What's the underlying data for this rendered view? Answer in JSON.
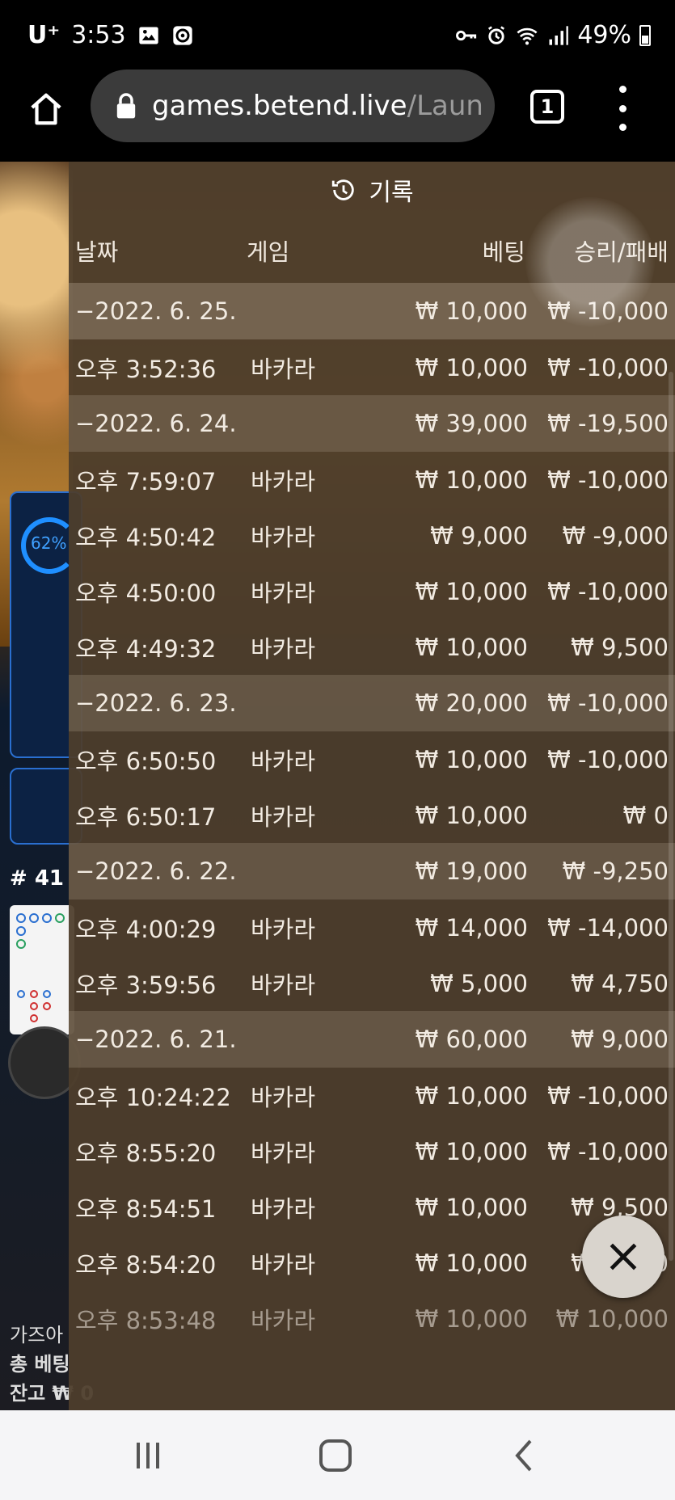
{
  "status": {
    "carrier": "U⁺",
    "time": "3:53",
    "battery": "49%"
  },
  "browser": {
    "url_host": "games.betend.live",
    "url_path": "/Laun",
    "tab_count": "1"
  },
  "game": {
    "progress_label": "62%",
    "progress_fraction": 0.62,
    "round": "# 41",
    "footer_1": "가즈아",
    "footer_2": "총 베팅",
    "footer_3": "잔고",
    "footer_balance": "₩ 0"
  },
  "history": {
    "title": "기록",
    "columns": {
      "date": "날짜",
      "game": "게임",
      "bet": "베팅",
      "win": "승리/패배"
    },
    "rows": [
      {
        "type": "group",
        "date": "−2022. 6. 25.",
        "bet": "₩ 10,000",
        "win": "₩ -10,000"
      },
      {
        "type": "item",
        "date": "오후 3:52:36",
        "game": "바카라",
        "bet": "₩ 10,000",
        "win": "₩ -10,000"
      },
      {
        "type": "group",
        "date": "−2022. 6. 24.",
        "bet": "₩ 39,000",
        "win": "₩ -19,500"
      },
      {
        "type": "item",
        "date": "오후 7:59:07",
        "game": "바카라",
        "bet": "₩ 10,000",
        "win": "₩ -10,000"
      },
      {
        "type": "item",
        "date": "오후 4:50:42",
        "game": "바카라",
        "bet": "₩ 9,000",
        "win": "₩ -9,000"
      },
      {
        "type": "item",
        "date": "오후 4:50:00",
        "game": "바카라",
        "bet": "₩ 10,000",
        "win": "₩ -10,000"
      },
      {
        "type": "item",
        "date": "오후 4:49:32",
        "game": "바카라",
        "bet": "₩ 10,000",
        "win": "₩ 9,500"
      },
      {
        "type": "group",
        "date": "−2022. 6. 23.",
        "bet": "₩ 20,000",
        "win": "₩ -10,000"
      },
      {
        "type": "item",
        "date": "오후 6:50:50",
        "game": "바카라",
        "bet": "₩ 10,000",
        "win": "₩ -10,000"
      },
      {
        "type": "item",
        "date": "오후 6:50:17",
        "game": "바카라",
        "bet": "₩ 10,000",
        "win": "₩ 0"
      },
      {
        "type": "group",
        "date": "−2022. 6. 22.",
        "bet": "₩ 19,000",
        "win": "₩ -9,250"
      },
      {
        "type": "item",
        "date": "오후 4:00:29",
        "game": "바카라",
        "bet": "₩ 14,000",
        "win": "₩ -14,000"
      },
      {
        "type": "item",
        "date": "오후 3:59:56",
        "game": "바카라",
        "bet": "₩ 5,000",
        "win": "₩ 4,750"
      },
      {
        "type": "group",
        "date": "−2022. 6. 21.",
        "bet": "₩ 60,000",
        "win": "₩ 9,000"
      },
      {
        "type": "item",
        "date": "오후 10:24:22",
        "game": "바카라",
        "bet": "₩ 10,000",
        "win": "₩ -10,000"
      },
      {
        "type": "item",
        "date": "오후 8:55:20",
        "game": "바카라",
        "bet": "₩ 10,000",
        "win": "₩ -10,000"
      },
      {
        "type": "item",
        "date": "오후 8:54:51",
        "game": "바카라",
        "bet": "₩ 10,000",
        "win": "₩ 9,500"
      },
      {
        "type": "item",
        "date": "오후 8:54:20",
        "game": "바카라",
        "bet": "₩ 10,000",
        "win": "₩ 9,500"
      },
      {
        "type": "item",
        "date": "오후 8:53:48",
        "game": "바카라",
        "bet": "₩ 10,000",
        "win": "₩ 10,000"
      }
    ]
  },
  "colors": {
    "overlay": "#4e3e2c",
    "group_row": "#6b5c4a",
    "accent_blue": "#1f8fff",
    "balance_gold": "#e6c200"
  },
  "icons": {
    "home": "home-icon",
    "lock": "lock-icon",
    "menu": "more-vert-icon",
    "history": "history-clock-icon",
    "close": "close-icon",
    "nav_recents": "recents-icon",
    "nav_home": "nav-home-icon",
    "nav_back": "back-icon"
  }
}
